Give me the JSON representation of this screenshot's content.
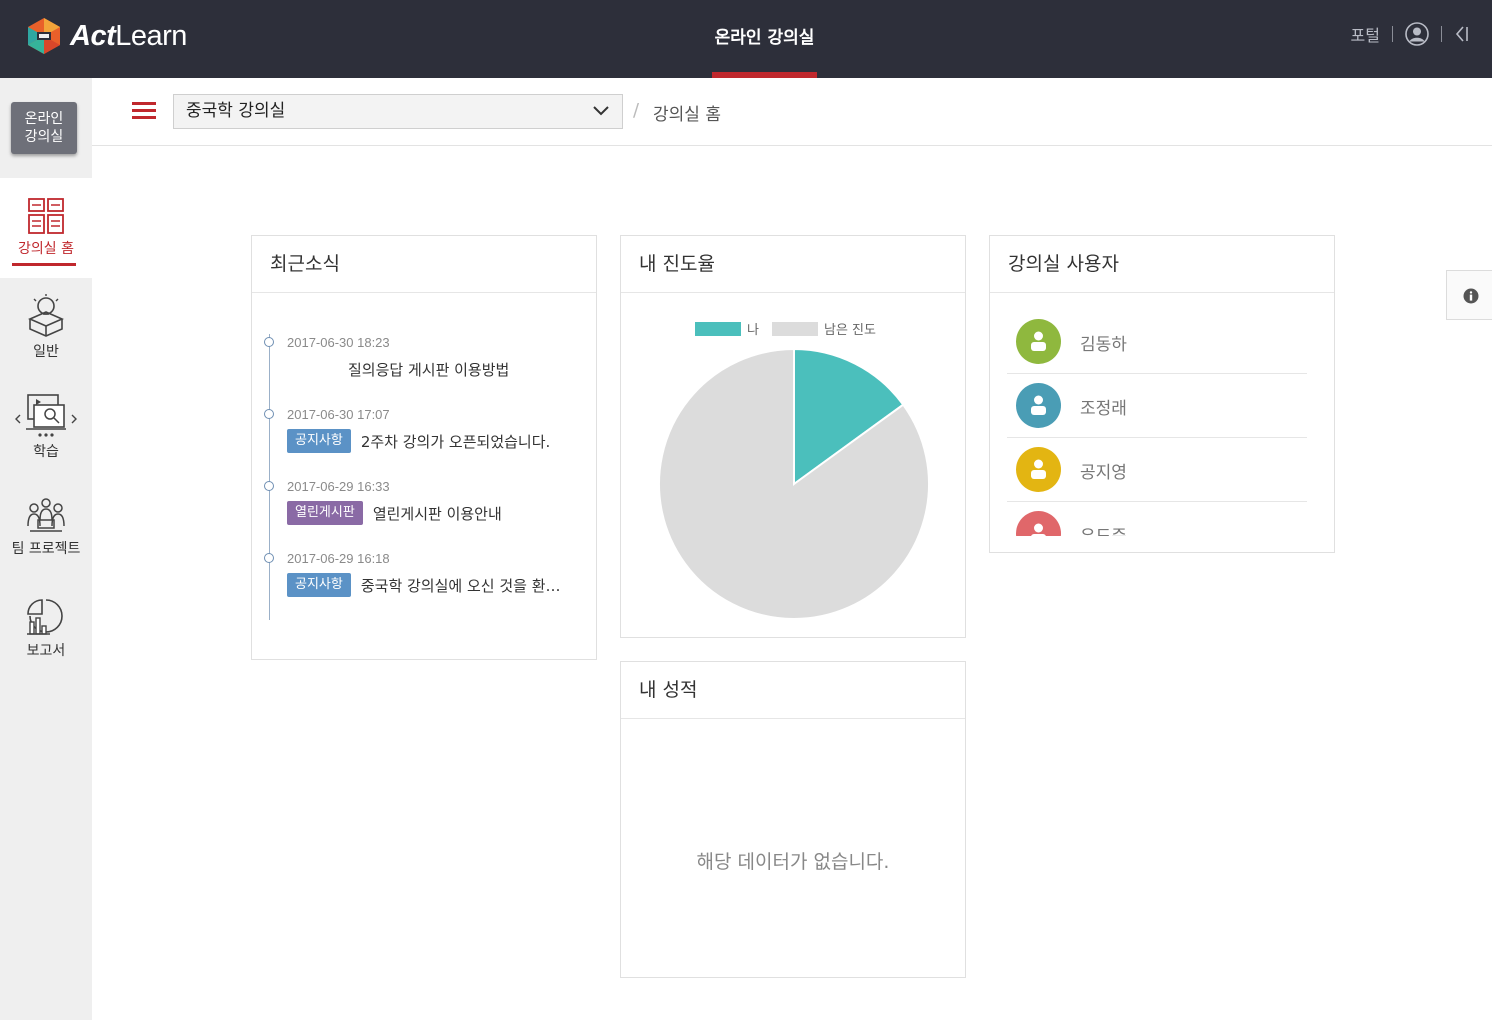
{
  "header": {
    "logo_act": "Act",
    "logo_learn": "Learn",
    "title": "온라인 강의실",
    "portal_label": "포털",
    "user_icon": "user-circle-icon",
    "collapse_icon": "collapse-left-icon"
  },
  "sidebar": {
    "online_button": [
      "온라인",
      "강의실"
    ],
    "items": [
      {
        "label": "강의실 홈",
        "icon": "classroom-home-icon",
        "active": true
      },
      {
        "label": "일반",
        "icon": "lightbulb-box-icon"
      },
      {
        "label": "학습",
        "icon": "learning-monitor-icon"
      },
      {
        "label": "팀 프로젝트",
        "icon": "team-icon"
      },
      {
        "label": "보고서",
        "icon": "report-chart-icon"
      }
    ]
  },
  "breadcrumb": {
    "menu_icon": "hamburger-icon",
    "course_selected": "중국학 강의실",
    "separator": "/",
    "current": "강의실 홈"
  },
  "news": {
    "title": "최근소식",
    "items": [
      {
        "date": "2017-06-30 18:23",
        "badge": "",
        "text": "질의응답 게시판 이용방법"
      },
      {
        "date": "2017-06-30 17:07",
        "badge": "공지사항",
        "badge_type": "notice",
        "text": "2주차 강의가 오픈되었습니다."
      },
      {
        "date": "2017-06-29 16:33",
        "badge": "열린게시판",
        "badge_type": "open",
        "text": "열린게시판 이용안내"
      },
      {
        "date": "2017-06-29 16:18",
        "badge": "공지사항",
        "badge_type": "notice",
        "text": "중국학 강의실에 오신 것을 환영합니다."
      }
    ]
  },
  "progress": {
    "title": "내 진도율",
    "legend_me": "나",
    "legend_rest": "남은 진도"
  },
  "chart_data": {
    "type": "pie",
    "categories": [
      "나",
      "남은 진도"
    ],
    "values": [
      15,
      85
    ],
    "colors": [
      "#4bbfbc",
      "#dcdcdc"
    ],
    "legend": "top"
  },
  "grades": {
    "title": "내 성적",
    "empty": "해당 데이터가 없습니다."
  },
  "users": {
    "title": "강의실 사용자",
    "list": [
      {
        "name": "김동하",
        "color": "#8fb83e"
      },
      {
        "name": "조정래",
        "color": "#4a9db5"
      },
      {
        "name": "공지영",
        "color": "#e3b512"
      },
      {
        "name": "유도준",
        "color": "#e0676a"
      }
    ]
  },
  "info_icon": "info-icon"
}
